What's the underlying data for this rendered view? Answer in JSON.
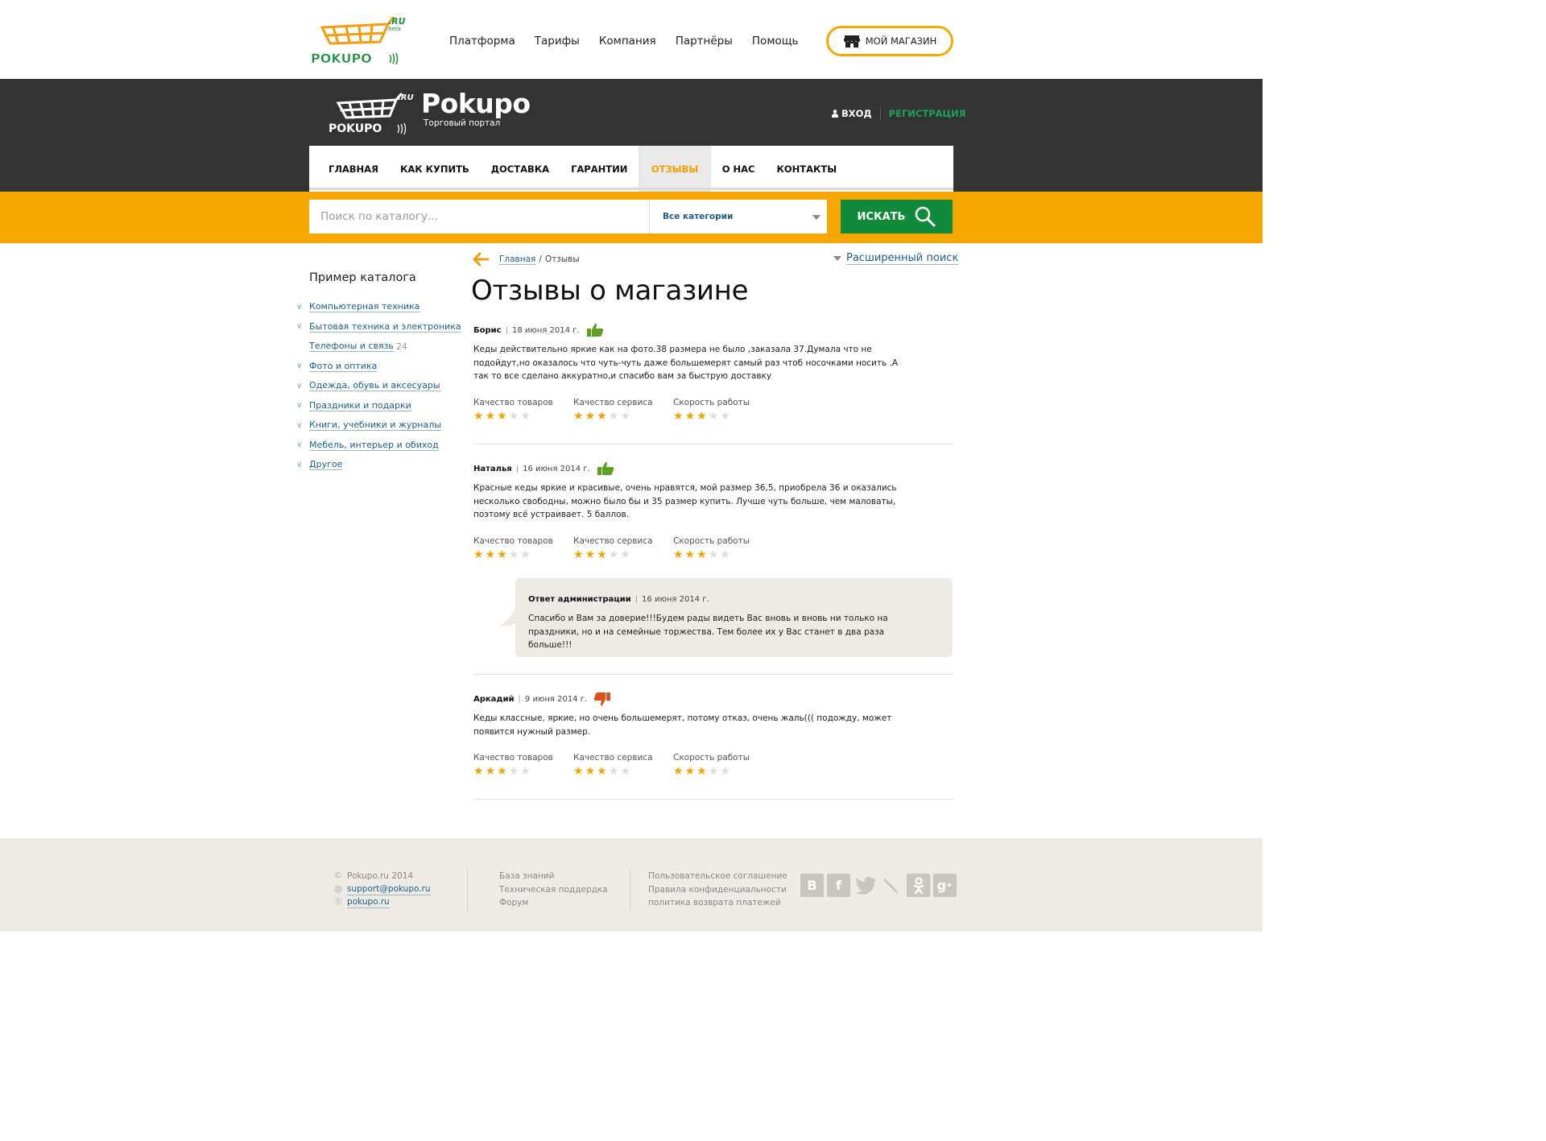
{
  "top_nav": {
    "logo_label": "POKUPO",
    "logo_suffix": ".RU",
    "logo_beta": "beta",
    "items": [
      "Платформа",
      "Тарифы",
      "Компания",
      "Партнёры",
      "Помощь"
    ],
    "my_shop": "МОЙ МАГАЗИН"
  },
  "header": {
    "logo_label": "POKUPO",
    "logo_suffix": ".RU",
    "brand": "Pokupo",
    "subtitle": "Торговый портал",
    "login": "ВХОД",
    "register": "РЕГИСТРАЦИЯ"
  },
  "main_nav": {
    "items": [
      "ГЛАВНАЯ",
      "КАК КУПИТЬ",
      "ДОСТАВКА",
      "ГАРАНТИИ",
      "ОТЗЫВЫ",
      "О НАС",
      "КОНТАКТЫ"
    ],
    "active_index": 4
  },
  "search": {
    "placeholder": "Поиск по каталогу...",
    "category": "Все категории",
    "button": "ИСКАТЬ"
  },
  "sidebar": {
    "title": "Пример каталога",
    "categories": [
      {
        "label": "Компьютерная техника",
        "expandable": true,
        "count": ""
      },
      {
        "label": "Бытовая техника и электроника",
        "expandable": true,
        "count": ""
      },
      {
        "label": "Телефоны и связь",
        "expandable": false,
        "count": "24"
      },
      {
        "label": "Фото и оптика",
        "expandable": true,
        "count": ""
      },
      {
        "label": "Одежда, обувь и аксесуары",
        "expandable": true,
        "count": ""
      },
      {
        "label": "Праздники и подарки",
        "expandable": true,
        "count": ""
      },
      {
        "label": "Книги, учебники и журналы",
        "expandable": true,
        "count": ""
      },
      {
        "label": "Мебель, интерьер и обиход",
        "expandable": true,
        "count": ""
      },
      {
        "label": "Другое",
        "expandable": true,
        "count": ""
      }
    ]
  },
  "breadcrumb": {
    "home": "Главная",
    "separator": "/",
    "current": "Отзывы"
  },
  "advanced_search": "Расширенный поиск",
  "page_title": "Отзывы о магазине",
  "rating_labels": [
    "Качество товаров",
    "Качество сервиса",
    "Скорость работы"
  ],
  "colors": {
    "accent": "#f6a800",
    "green": "#118a3b",
    "like": "#5fa020",
    "dislike": "#d9531e"
  },
  "reviews": [
    {
      "author": "Борис",
      "date": "18 июня 2014 г.",
      "sentiment": "positive",
      "text": "Кеды действительно яркие как на фото.38 размера не было ,заказала 37.Думала что не подойдут,но оказалось что чуть-чуть даже большемерят самый раз чтоб носочками носить .А так то все сделано аккуратно,и спасибо вам за быструю доставку",
      "ratings": [
        3,
        3,
        3
      ]
    },
    {
      "author": "Наталья",
      "date": "16 июня 2014 г.",
      "sentiment": "positive",
      "text": "Красные кеды яркие и красивые, очень нравятся, мой размер 36,5, приобрела 36 и оказались несколько свободны, можно было бы и 35 размер купить. Лучше чуть больше, чем маловаты, поэтому всё устраивает. 5 баллов.",
      "ratings": [
        3,
        3,
        3
      ]
    },
    {
      "author": "Аркадий",
      "date": "9 июня 2014 г.",
      "sentiment": "negative",
      "text": "Кеды классные, яркие, но очень большемерят, потому отказ, очень жаль((( подожду, может появится нужный размер.",
      "ratings": [
        3,
        3,
        3
      ]
    }
  ],
  "admin_reply": {
    "author": "Ответ администрации",
    "date": "16 июня 2014 г.",
    "text": "Спасибо и Вам за доверие!!!Будем рады видеть Вас вновь и вновь ни только на праздники, но и на семейные торжества. Тем более их у Вас станет в два раза больше!!!"
  },
  "footer": {
    "copyright": "Pokupo.ru 2014",
    "email": "support@pokupo.ru",
    "skype": "pokupo.ru",
    "links_col2": [
      "База знаний",
      "Техническая поддердка",
      "Форум"
    ],
    "links_col3": [
      "Пользовательское соглашение",
      "Правила конфиденциальности",
      "политика возврата платежей"
    ],
    "social_icons": [
      "vk-icon",
      "facebook-icon",
      "twitter-icon",
      "livejournal-icon",
      "odnoklassniki-icon",
      "google-plus-icon"
    ]
  }
}
